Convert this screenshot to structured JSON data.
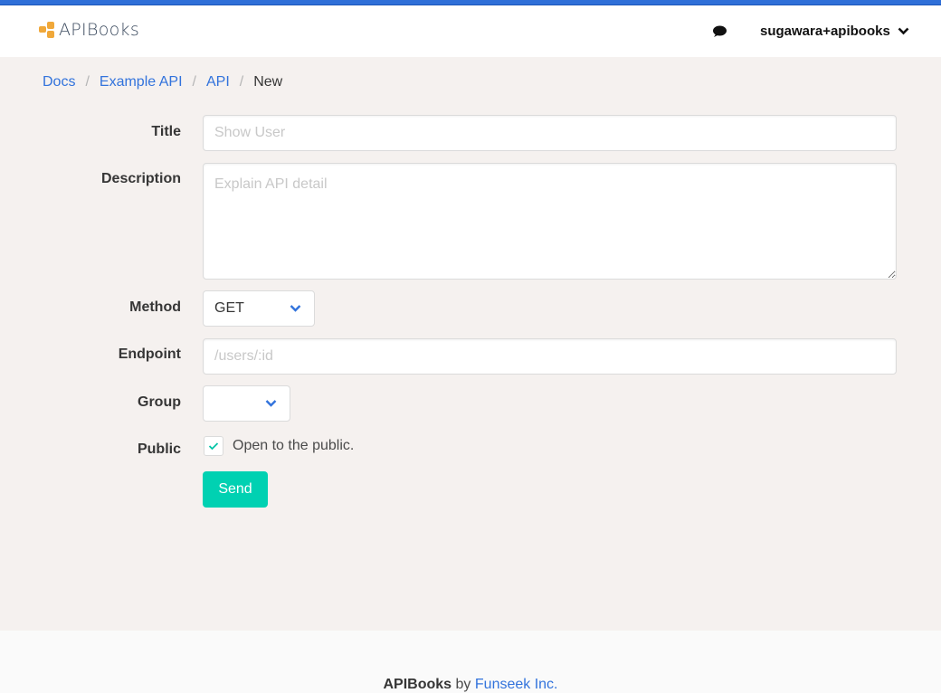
{
  "header": {
    "brand": "APIBooks",
    "username": "sugawara+apibooks",
    "icons": {
      "chat": "chat-bubble-icon",
      "dropdown": "chevron-down-icon"
    }
  },
  "breadcrumb": [
    {
      "label": "Docs",
      "link": true
    },
    {
      "label": "Example API",
      "link": true
    },
    {
      "label": "API",
      "link": true
    },
    {
      "label": "New",
      "link": false
    }
  ],
  "form": {
    "title": {
      "label": "Title",
      "value": "",
      "placeholder": "Show User"
    },
    "description": {
      "label": "Description",
      "value": "",
      "placeholder": "Explain API detail"
    },
    "method": {
      "label": "Method",
      "selected": "GET"
    },
    "endpoint": {
      "label": "Endpoint",
      "value": "",
      "placeholder": "/users/:id"
    },
    "group": {
      "label": "Group",
      "selected": ""
    },
    "public": {
      "label": "Public",
      "checkbox_label": "Open to the public.",
      "checked": true
    },
    "submit_label": "Send"
  },
  "footer": {
    "brand": "APIBooks",
    "by": "by",
    "company": "Funseek Inc."
  },
  "colors": {
    "link": "#3273dc",
    "primary_button": "#00d1b2",
    "brand_icon": "#f0a83a",
    "page_background": "#f5f1ef"
  }
}
